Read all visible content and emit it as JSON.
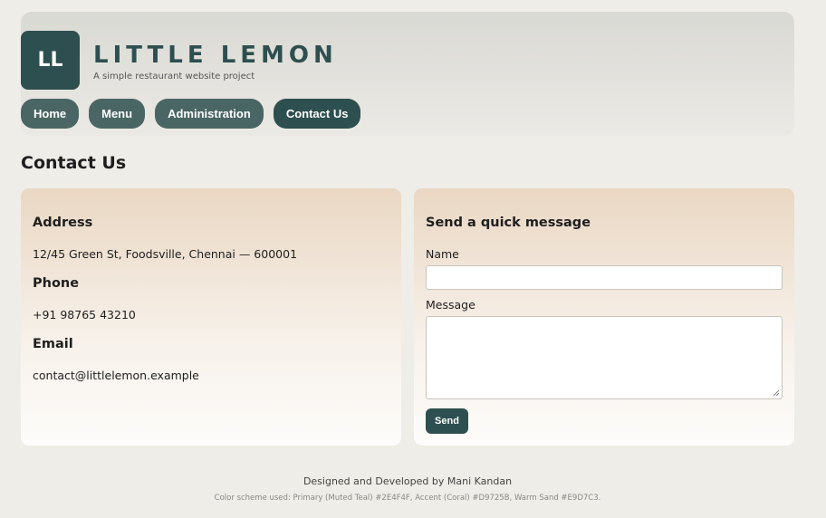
{
  "brand": {
    "logo_text": "LL",
    "title": "LITTLE LEMON",
    "subtitle": "A simple restaurant website project"
  },
  "nav": {
    "items": [
      {
        "label": "Home"
      },
      {
        "label": "Menu"
      },
      {
        "label": "Administration"
      },
      {
        "label": "Contact Us",
        "active": true
      }
    ]
  },
  "page": {
    "title": "Contact Us"
  },
  "contact_info": {
    "address_heading": "Address",
    "address": "12/45 Green St, Foodsville, Chennai — 600001",
    "phone_heading": "Phone",
    "phone": "+91 98765 43210",
    "email_heading": "Email",
    "email": "contact@littlelemon.example"
  },
  "message_form": {
    "heading": "Send a quick message",
    "name_label": "Name",
    "name_value": "",
    "message_label": "Message",
    "message_value": "",
    "send_label": "Send"
  },
  "footer": {
    "credit": "Designed and Developed by Mani Kandan",
    "color_note": "Color scheme used: Primary (Muted Teal) #2E4F4F, Accent (Coral) #D9725B, Warm Sand #E9D7C3."
  },
  "colors": {
    "primary": "#2E4F4F",
    "accent": "#D9725B",
    "warm_sand": "#E9D7C3",
    "background": "#EFEDE8"
  }
}
